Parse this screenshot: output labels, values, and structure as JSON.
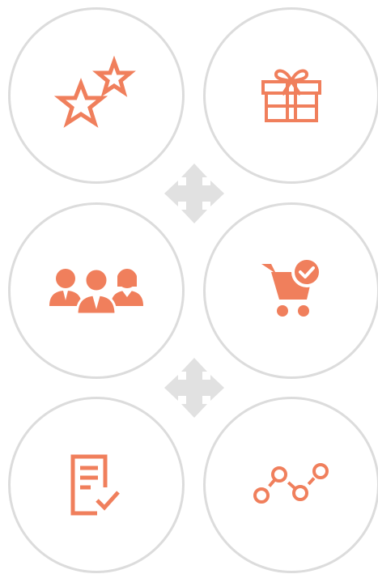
{
  "colors": {
    "accent": "#f07f5c",
    "circle_border": "#dcdcdc",
    "move_icon": "#e1e1e1"
  },
  "icons": [
    "stars-icon",
    "gift-icon",
    "team-icon",
    "cart-check-icon",
    "document-check-icon",
    "line-chart-icon"
  ],
  "connectors": [
    "move-arrows-icon",
    "move-arrows-icon"
  ]
}
